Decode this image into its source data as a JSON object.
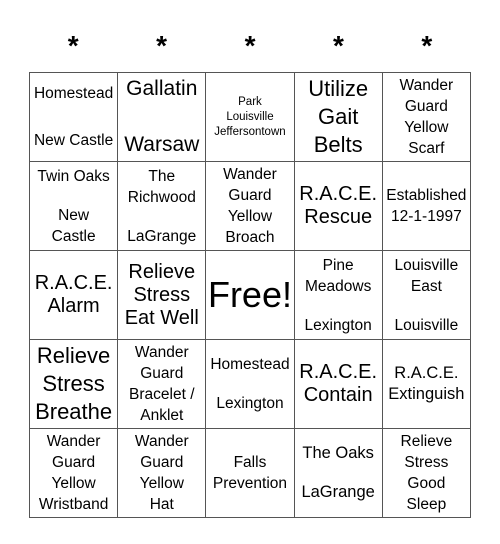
{
  "header": {
    "columns": [
      "*",
      "*",
      "*",
      "*",
      "*"
    ]
  },
  "card": {
    "rows": [
      [
        {
          "lines": [
            "Homestead",
            "New Castle"
          ],
          "style": "s15",
          "layout": "spread2"
        },
        {
          "lines": [
            "Gallatin",
            "Warsaw"
          ],
          "style": "s21",
          "layout": "spread"
        },
        {
          "lines": [
            "Park",
            "Louisville",
            "Jeffersontown"
          ],
          "style": "s11",
          "layout": "center"
        },
        {
          "lines": [
            "Utilize",
            "Gait",
            "Belts"
          ],
          "style": "s22",
          "layout": "center"
        },
        {
          "lines": [
            "Wander",
            "Guard",
            "Yellow",
            "Scarf"
          ],
          "style": "s15",
          "layout": "center"
        }
      ],
      [
        {
          "lines": [
            "Twin Oaks",
            "",
            "New",
            "Castle"
          ],
          "style": "s15",
          "layout": "center"
        },
        {
          "lines": [
            "The",
            "Richwood",
            "",
            "LaGrange"
          ],
          "style": "s15",
          "layout": "center"
        },
        {
          "lines": [
            "Wander",
            "Guard",
            "Yellow",
            "Broach"
          ],
          "style": "s15",
          "layout": "center"
        },
        {
          "lines": [
            "R.A.C.E.",
            "Rescue"
          ],
          "style": "s20",
          "layout": "center"
        },
        {
          "lines": [
            "Established",
            "12-1-1997"
          ],
          "style": "s15",
          "layout": "center"
        }
      ],
      [
        {
          "lines": [
            "R.A.C.E.",
            "Alarm"
          ],
          "style": "s20",
          "layout": "center"
        },
        {
          "lines": [
            "Relieve",
            "Stress",
            "Eat Well"
          ],
          "style": "s20",
          "layout": "center"
        },
        {
          "lines": [
            "Free!"
          ],
          "style": "s36",
          "layout": "center"
        },
        {
          "lines": [
            "Pine",
            "Meadows",
            "",
            "Lexington"
          ],
          "style": "s15",
          "layout": "center"
        },
        {
          "lines": [
            "Louisville",
            "East",
            "",
            "Louisville"
          ],
          "style": "s15",
          "layout": "center"
        }
      ],
      [
        {
          "lines": [
            "Relieve",
            "Stress",
            "Breathe"
          ],
          "style": "s22",
          "layout": "center"
        },
        {
          "lines": [
            "Wander",
            "Guard",
            "Bracelet /",
            "Anklet"
          ],
          "style": "s15",
          "layout": "center"
        },
        {
          "lines": [
            "Homestead",
            "",
            "Lexington"
          ],
          "style": "s15",
          "layout": "center"
        },
        {
          "lines": [
            "R.A.C.E.",
            "Contain"
          ],
          "style": "s20",
          "layout": "center"
        },
        {
          "lines": [
            "R.A.C.E.",
            "Extinguish"
          ],
          "style": "s17",
          "layout": "center"
        }
      ],
      [
        {
          "lines": [
            "Wander",
            "Guard",
            "Yellow",
            "Wristband"
          ],
          "style": "s15",
          "layout": "center"
        },
        {
          "lines": [
            "Wander",
            "Guard",
            "Yellow",
            "Hat"
          ],
          "style": "s15",
          "layout": "center"
        },
        {
          "lines": [
            "Falls",
            "Prevention"
          ],
          "style": "s15",
          "layout": "center"
        },
        {
          "lines": [
            "The Oaks",
            "",
            "LaGrange"
          ],
          "style": "s17",
          "layout": "center"
        },
        {
          "lines": [
            "Relieve",
            "Stress",
            "Good",
            "Sleep"
          ],
          "style": "s15",
          "layout": "center"
        }
      ]
    ]
  }
}
